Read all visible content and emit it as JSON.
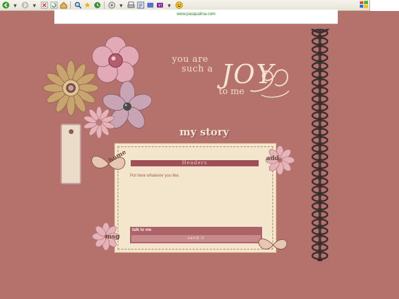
{
  "browser": {
    "toolbar_icons": [
      "back-icon",
      "dropdown-icon",
      "forward-icon",
      "stop-icon",
      "refresh-icon",
      "home-icon",
      "search-icon",
      "favorites-icon",
      "history-icon",
      "media-icon",
      "print-icon",
      "edit-icon",
      "messenger-icon",
      "yahoo-icon",
      "smiley-icon"
    ]
  },
  "site": {
    "url_text": "www.pasqualina.com"
  },
  "headline": {
    "line1": "you are",
    "line2": "such a",
    "emphasis": "JOY",
    "line3": "to me"
  },
  "section_title": "my story",
  "card": {
    "header": "Headers",
    "body": "Put here whatever you like.",
    "talk_label": "talk to me",
    "send_button": "send it"
  },
  "badges": {
    "home": "home",
    "add": "add",
    "msg": "msg"
  },
  "colors": {
    "background": "#b5726d",
    "card": "#f3e6cc",
    "accent": "#9e4f57"
  }
}
